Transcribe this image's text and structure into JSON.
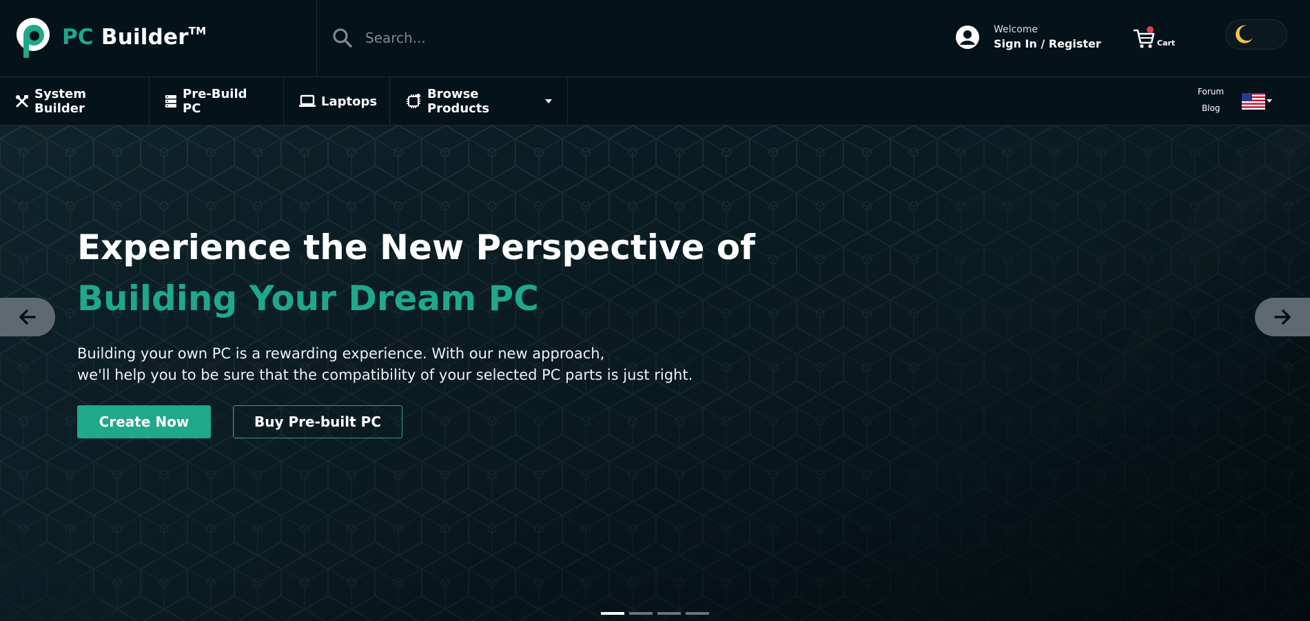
{
  "header": {
    "logo": {
      "part1": "PC",
      "part2": " Builder",
      "tm": "TM"
    },
    "search": {
      "placeholder": "Search..."
    },
    "account": {
      "welcome": "Welcome",
      "signin": "Sign In / Register"
    },
    "cart": {
      "label": "Cart"
    }
  },
  "nav": {
    "items": [
      {
        "label": "System Builder",
        "icon": "tools-icon"
      },
      {
        "label": "Pre-Build PC",
        "icon": "server-icon"
      },
      {
        "label": "Laptops",
        "icon": "laptop-icon"
      },
      {
        "label": "Browse Products",
        "icon": "cpu-chip-icon"
      }
    ],
    "side": {
      "forum": "Forum",
      "blog": "Blog"
    },
    "language_flag": "us-flag-icon"
  },
  "hero": {
    "title_line1": "Experience the New Perspective of",
    "title_line2": "Building Your Dream PC",
    "desc_line1": "Building your own PC is a rewarding experience. With our new approach,",
    "desc_line2": "we'll help you to be sure that the compatibility of your selected PC parts is just right.",
    "primary_button": "Create Now",
    "secondary_button": "Buy Pre-built PC",
    "slide_count": 4,
    "active_slide": 1
  },
  "colors": {
    "accent": "#1fa88a",
    "background": "#04121a",
    "notification": "#e0414e"
  }
}
